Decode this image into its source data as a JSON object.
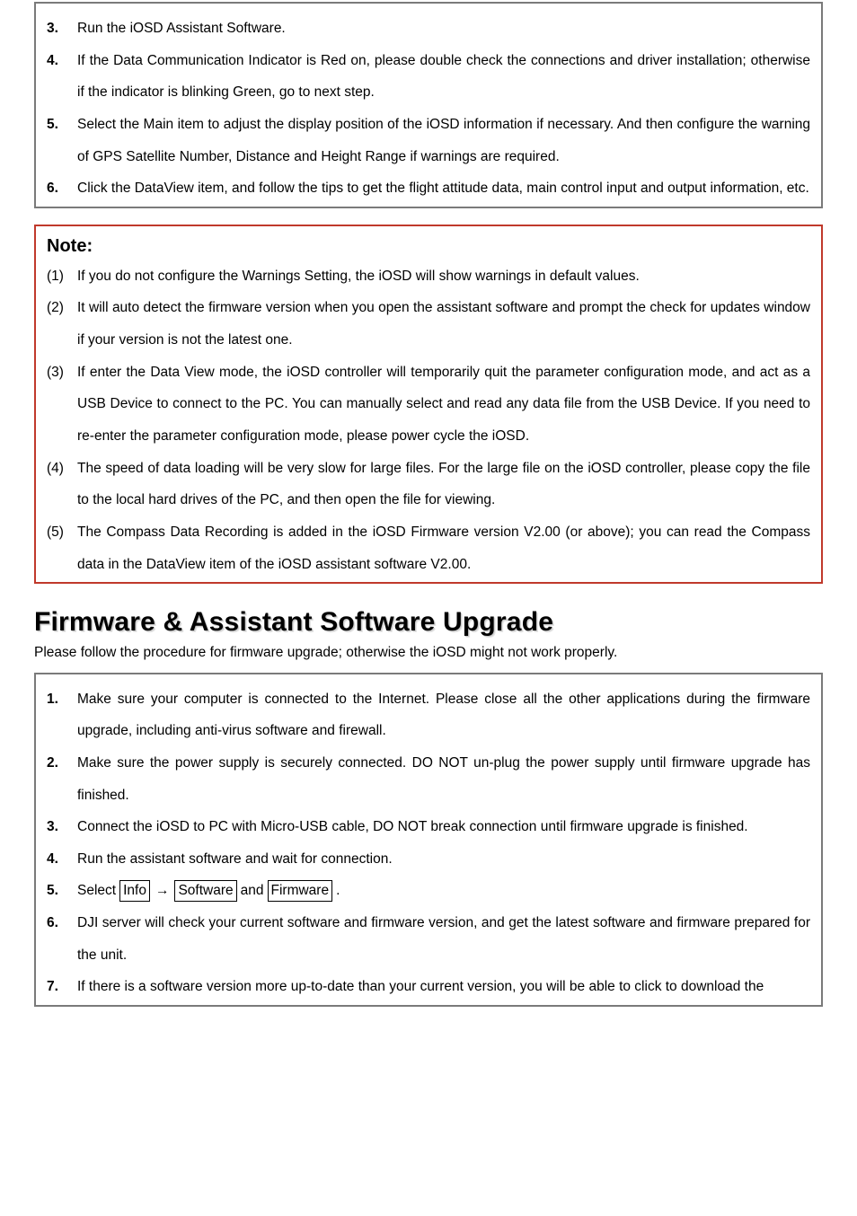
{
  "stepsA": [
    {
      "num": "3.",
      "text": "Run the iOSD Assistant Software."
    },
    {
      "num": "4.",
      "text": "If the Data Communication Indicator is Red on, please double check the connections and driver installation; otherwise if the indicator is blinking Green, go to next step."
    },
    {
      "num": "5.",
      "text": "Select the Main item to adjust the display position of the iOSD information if necessary. And then configure the warning of GPS Satellite Number, Distance and Height Range if warnings are required."
    },
    {
      "num": "6.",
      "text": "Click the DataView item, and follow the tips to get the flight attitude data, main control input and output information, etc."
    }
  ],
  "note": {
    "title": "Note:",
    "items": [
      {
        "num": "(1)",
        "text": "If you do not configure the Warnings Setting, the iOSD will show warnings in default values."
      },
      {
        "num": "(2)",
        "text": "It will auto detect the firmware version when you open the assistant software and prompt the check for updates window if your version is not the latest one."
      },
      {
        "num": "(3)",
        "text": "If enter the Data View mode, the iOSD controller will temporarily quit the parameter configuration mode, and act as a USB Device to connect to the PC. You can manually select and read any data file from the USB Device. If you need to re-enter the parameter configuration mode, please power cycle the iOSD."
      },
      {
        "num": "(4)",
        "text": "The speed of data loading will be very slow for large files. For the large file on the iOSD controller, please copy the file to the local hard drives of the PC, and then open the file for viewing."
      },
      {
        "num": "(5)",
        "text": "The Compass Data Recording is added in the iOSD Firmware version V2.00 (or above); you can read the Compass data in the DataView item of the iOSD assistant software V2.00."
      }
    ]
  },
  "section": {
    "heading": "Firmware & Assistant Software Upgrade",
    "lead": "Please follow the procedure for firmware upgrade; otherwise the iOSD might not work properly."
  },
  "stepsB": [
    {
      "num": "1.",
      "text": "Make sure your computer is connected to the Internet. Please close all the other applications during the firmware upgrade, including anti-virus software and firewall."
    },
    {
      "num": "2.",
      "text": "Make sure the power supply is securely connected. DO NOT un-plug the power supply until firmware upgrade has finished."
    },
    {
      "num": "3.",
      "text": "Connect the iOSD to PC with Micro-USB cable, DO NOT break connection until firmware upgrade is finished."
    },
    {
      "num": "4.",
      "text": "Run the assistant software and wait for connection."
    },
    {
      "num": "5.",
      "select": {
        "prefix": "Select",
        "a": "Info",
        "b": "Software",
        "mid": "and",
        "c": "Firmware",
        "suffix": "."
      }
    },
    {
      "num": "6.",
      "text": "DJI server will check your current software and firmware version, and get the latest software and firmware prepared for the unit."
    },
    {
      "num": "7.",
      "text": "If there is a software version more up-to-date than your current version, you will be able to click to download the"
    }
  ],
  "glyphs": {
    "arrow": "→"
  }
}
